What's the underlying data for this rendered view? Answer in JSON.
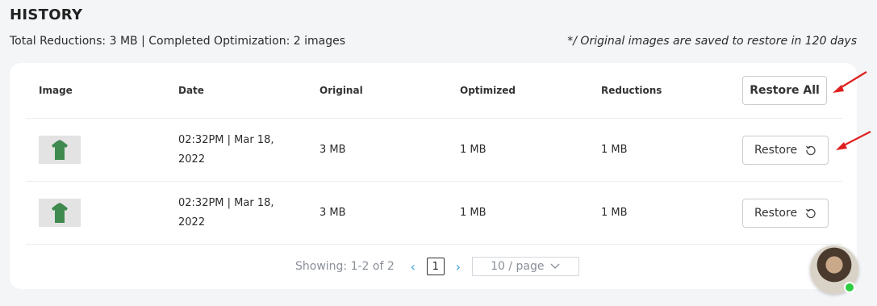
{
  "page": {
    "title": "HISTORY",
    "summary": "Total Reductions: 3 MB | Completed Optimization: 2 images",
    "note": "*/ Original images are saved to restore in 120 days"
  },
  "table": {
    "headers": {
      "image": "Image",
      "date": "Date",
      "original": "Original",
      "optimized": "Optimized",
      "reductions": "Reductions"
    },
    "restore_all_label": "Restore All",
    "rows": [
      {
        "thumbnail_icon": "green-shirt-thumbnail",
        "date_line1": "02:32PM | Mar 18,",
        "date_line2": "2022",
        "original": "3 MB",
        "optimized": "1 MB",
        "reductions": "1 MB",
        "restore_label": "Restore",
        "restore_icon": "restore-icon"
      },
      {
        "thumbnail_icon": "green-shirt-thumbnail",
        "date_line1": "02:32PM | Mar 18,",
        "date_line2": "2022",
        "original": "3 MB",
        "optimized": "1 MB",
        "reductions": "1 MB",
        "restore_label": "Restore",
        "restore_icon": "restore-icon"
      }
    ]
  },
  "pagination": {
    "showing": "Showing: 1-2 of 2",
    "prev_icon": "chevron-left-icon",
    "current_page": "1",
    "next_icon": "chevron-right-icon",
    "page_size": "10 / page",
    "page_size_icon": "chevron-down-icon"
  },
  "annotations": {
    "arrow_color": "#e02020"
  },
  "chat_widget": {
    "avatar_icon": "support-avatar",
    "status_color": "#2ecc40"
  }
}
